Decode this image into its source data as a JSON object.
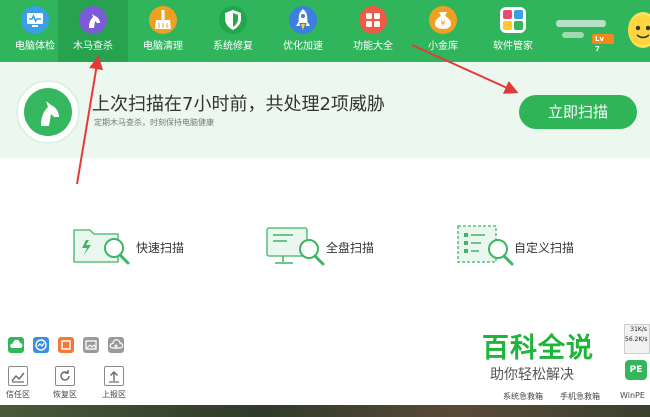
{
  "nav": {
    "items": [
      {
        "label": "电脑体检",
        "icon": "monitor-check-icon"
      },
      {
        "label": "木马查杀",
        "icon": "horse-icon"
      },
      {
        "label": "电脑清理",
        "icon": "broom-icon"
      },
      {
        "label": "系统修复",
        "icon": "shield-icon"
      },
      {
        "label": "优化加速",
        "icon": "rocket-icon"
      },
      {
        "label": "功能大全",
        "icon": "grid-icon"
      },
      {
        "label": "小金库",
        "icon": "money-bag-icon"
      },
      {
        "label": "软件管家",
        "icon": "apps-icon"
      }
    ],
    "active_index": 1,
    "level": "Lv 7"
  },
  "banner": {
    "title": "上次扫描在7小时前，共处理2项威胁",
    "subtitle": "定期木马查杀，时刻保持电脑健康",
    "scan_button": "立即扫描"
  },
  "scan_options": [
    {
      "label": "快速扫描",
      "icon": "folder-search-icon"
    },
    {
      "label": "全盘扫描",
      "icon": "monitor-search-icon"
    },
    {
      "label": "自定义扫描",
      "icon": "list-search-icon"
    }
  ],
  "bottom_tools": [
    {
      "label": "信任区",
      "icon": "trust-zone-icon"
    },
    {
      "label": "恢复区",
      "icon": "restore-zone-icon"
    },
    {
      "label": "上报区",
      "icon": "report-zone-icon"
    }
  ],
  "watermark": {
    "title": "百科全说",
    "subtitle": "助你轻松解决"
  },
  "bottom_links": [
    "系统急救箱",
    "手机急救箱",
    "WinPE"
  ],
  "speed": {
    "up": "31K/s",
    "down": "56.2K/s"
  },
  "pe_label": "PE",
  "colors": {
    "brand": "#30b55c",
    "accent_arrow": "#e53935",
    "banner_bg": "#ecf8ef"
  }
}
